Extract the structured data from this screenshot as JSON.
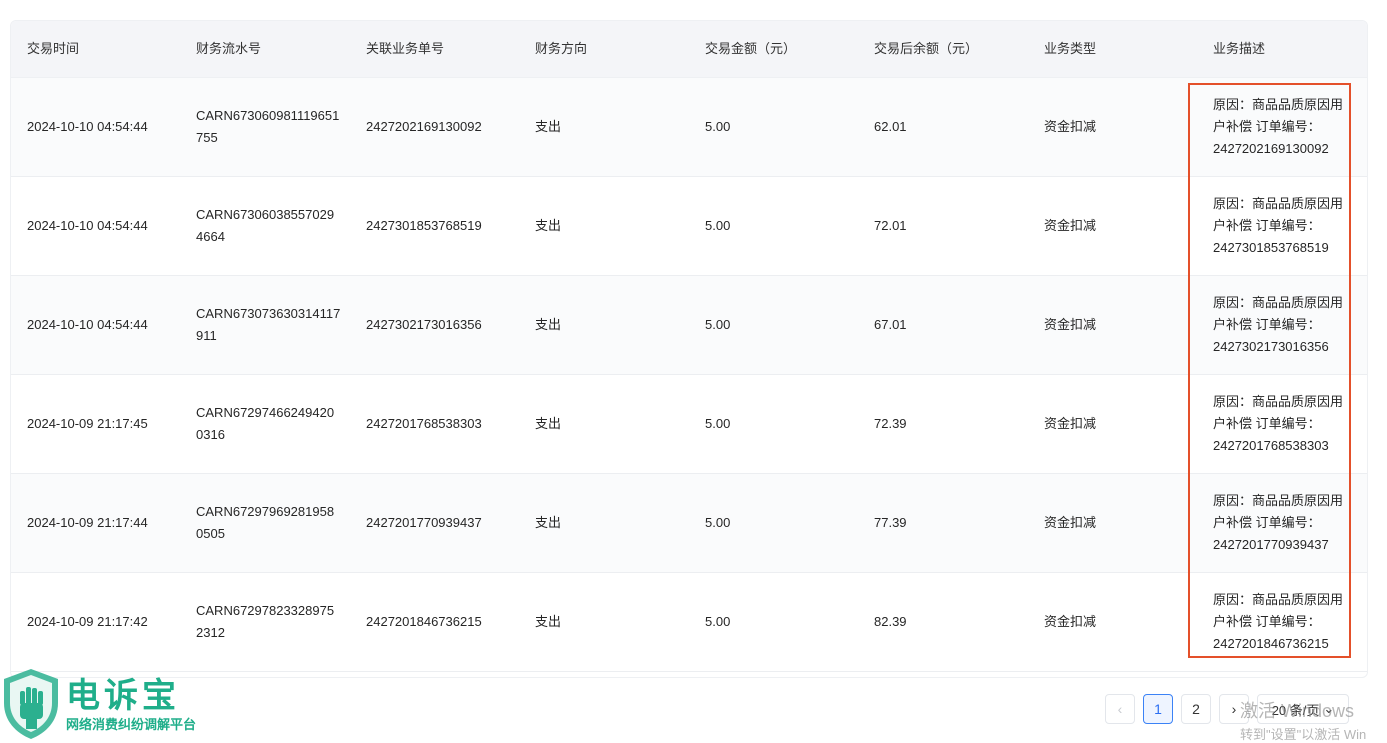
{
  "table": {
    "headers": [
      "交易时间",
      "财务流水号",
      "关联业务单号",
      "财务方向",
      "交易金额（元）",
      "交易后余额（元）",
      "业务类型",
      "业务描述"
    ],
    "rows": [
      {
        "time": "2024-10-10 04:54:44",
        "serial": "CARN673060981119651755",
        "order": "2427202169130092",
        "direction": "支出",
        "amount": "5.00",
        "balance": "62.01",
        "type": "资金扣减",
        "desc": "原因：商品品质原因用户补偿 订单编号：2427202169130092"
      },
      {
        "time": "2024-10-10 04:54:44",
        "serial": "CARN673060385570294664",
        "order": "2427301853768519",
        "direction": "支出",
        "amount": "5.00",
        "balance": "72.01",
        "type": "资金扣减",
        "desc": "原因：商品品质原因用户补偿 订单编号：2427301853768519"
      },
      {
        "time": "2024-10-10 04:54:44",
        "serial": "CARN673073630314117911",
        "order": "2427302173016356",
        "direction": "支出",
        "amount": "5.00",
        "balance": "67.01",
        "type": "资金扣减",
        "desc": "原因：商品品质原因用户补偿 订单编号：2427302173016356"
      },
      {
        "time": "2024-10-09 21:17:45",
        "serial": "CARN672974662494200316",
        "order": "2427201768538303",
        "direction": "支出",
        "amount": "5.00",
        "balance": "72.39",
        "type": "资金扣减",
        "desc": "原因：商品品质原因用户补偿 订单编号：2427201768538303"
      },
      {
        "time": "2024-10-09 21:17:44",
        "serial": "CARN672979692819580505",
        "order": "2427201770939437",
        "direction": "支出",
        "amount": "5.00",
        "balance": "77.39",
        "type": "资金扣减",
        "desc": "原因：商品品质原因用户补偿 订单编号：2427201770939437"
      },
      {
        "time": "2024-10-09 21:17:42",
        "serial": "CARN672978233289752312",
        "order": "2427201846736215",
        "direction": "支出",
        "amount": "5.00",
        "balance": "82.39",
        "type": "资金扣减",
        "desc": "原因：商品品质原因用户补偿 订单编号：2427201846736215"
      }
    ]
  },
  "pagination": {
    "prev_icon": "chevron-left-icon",
    "pages": [
      "1",
      "2"
    ],
    "current": "1",
    "next_icon": "chevron-right-icon",
    "page_size": "20 条/页"
  },
  "watermark": {
    "line1": "激活 Windows",
    "line2": "转到\"设置\"以激活 Win"
  },
  "logo": {
    "title": "电诉宝",
    "subtitle": "网络消费纠纷调解平台",
    "icon": "shield-fist-icon"
  },
  "colors": {
    "highlight": "#e4502a",
    "brand": "#1fae8a",
    "pagination_active": "#2a6ef2"
  }
}
